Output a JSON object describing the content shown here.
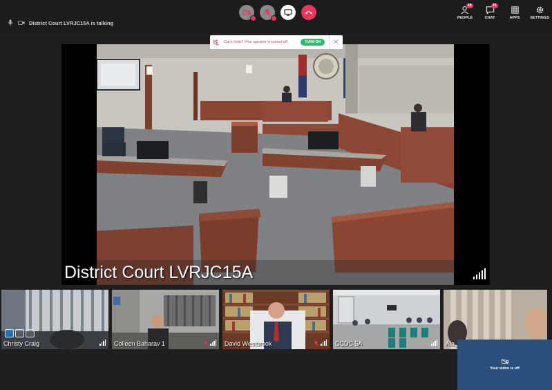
{
  "topbar": {
    "talking_text": "District Court LVRJC15A is talking",
    "nav": [
      {
        "label": "PEOPLE",
        "icon": "people-icon",
        "badge": "10"
      },
      {
        "label": "CHAT",
        "icon": "chat-icon",
        "badge": "21"
      },
      {
        "label": "APPS",
        "icon": "apps-icon",
        "badge": ""
      },
      {
        "label": "SETTINGS",
        "icon": "settings-icon",
        "badge": ""
      }
    ]
  },
  "notification": {
    "message": "Can't hear? Your speaker is turned off.",
    "action": "TURN ON"
  },
  "main_video": {
    "label": "District Court LVRJC15A"
  },
  "participants": [
    {
      "name": "Christy Craig"
    },
    {
      "name": "Colleen Baharav 1"
    },
    {
      "name": "David Westbrook"
    },
    {
      "name": "CCDC 5A"
    },
    {
      "name": "Ala"
    }
  ],
  "self_view": {
    "status": "Your video is off"
  },
  "colors": {
    "accent_red": "#e8365d",
    "accent_green": "#2dbd6e",
    "background": "#1f1f1f"
  }
}
